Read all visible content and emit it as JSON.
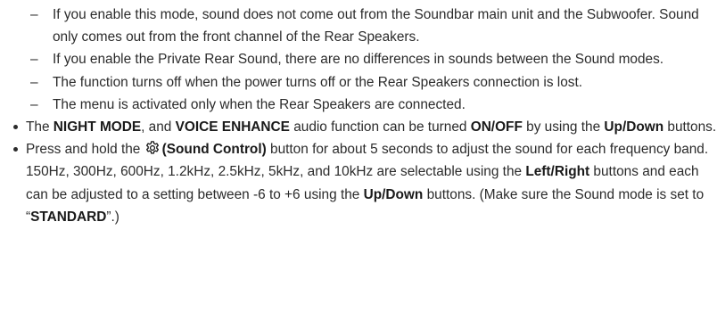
{
  "sub_bullets": [
    "If you enable this mode, sound does not come out from the Soundbar main unit and the Subwoofer. Sound only comes out from the front channel of the Rear Speakers.",
    "If you enable the Private Rear Sound, there are no differences in sounds between the Sound modes.",
    "The function turns off when the power turns off or the Rear Speakers connection is lost.",
    "The menu is activated only when the Rear Speakers are connected."
  ],
  "dash_glyph": "–",
  "bullet2": {
    "t1": "The ",
    "b1": "NIGHT MODE",
    "t2": ", and ",
    "b2": "VOICE ENHANCE",
    "t3": " audio function can be turned ",
    "b3": "ON/OFF",
    "t4": " by using the ",
    "b4": "Up/Down",
    "t5": " buttons."
  },
  "bullet3": {
    "t1": "Press and hold the ",
    "icon": "gear-icon",
    "b1": "(Sound Control)",
    "t2": " button for about 5 seconds to adjust the sound for each frequency band. 150Hz, 300Hz, 600Hz, 1.2kHz, 2.5kHz, 5kHz, and 10kHz are selectable using the ",
    "b2": "Left/Right",
    "t3": " buttons and each can be adjusted to a setting between -6 to +6 using the ",
    "b3": "Up/Down",
    "t4": " buttons. (Make sure the Sound mode is set to “",
    "b4": "STANDARD",
    "t5": "”.)"
  }
}
